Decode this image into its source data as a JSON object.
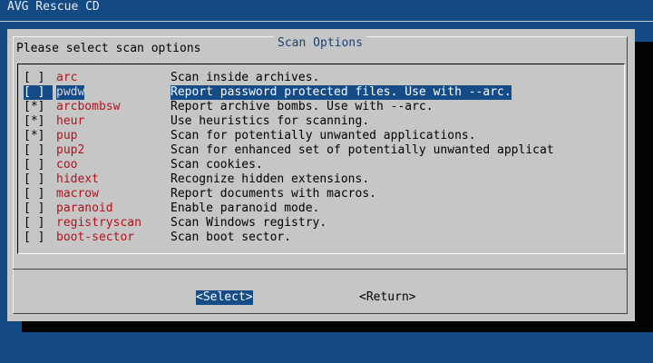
{
  "app": {
    "backtitle": "AVG Rescue CD"
  },
  "dialog": {
    "title": "Scan Options",
    "prompt": "Please select scan options",
    "options": [
      {
        "check": "[ ]",
        "tag": "arc",
        "desc": "Scan inside archives.",
        "selected": false
      },
      {
        "check": "[ ]",
        "tag": "pwdw",
        "desc": "Report password protected files. Use with --arc.",
        "selected": true
      },
      {
        "check": "[*]",
        "tag": "arcbombsw",
        "desc": "Report archive bombs. Use with --arc.",
        "selected": false
      },
      {
        "check": "[*]",
        "tag": "heur",
        "desc": "Use heuristics for scanning.",
        "selected": false
      },
      {
        "check": "[*]",
        "tag": "pup",
        "desc": "Scan for potentially unwanted applications.",
        "selected": false
      },
      {
        "check": "[ ]",
        "tag": "pup2",
        "desc": "Scan for enhanced set of potentially unwanted applicat",
        "selected": false
      },
      {
        "check": "[ ]",
        "tag": "coo",
        "desc": "Scan cookies.",
        "selected": false
      },
      {
        "check": "[ ]",
        "tag": "hidext",
        "desc": "Recognize hidden extensions.",
        "selected": false
      },
      {
        "check": "[ ]",
        "tag": "macrow",
        "desc": "Report documents with macros.",
        "selected": false
      },
      {
        "check": "[ ]",
        "tag": "paranoid",
        "desc": "Enable paranoid mode.",
        "selected": false
      },
      {
        "check": "[ ]",
        "tag": "registryscan",
        "desc": "Scan Windows registry.",
        "selected": false
      },
      {
        "check": "[ ]",
        "tag": "boot-sector",
        "desc": "Scan boot sector.",
        "selected": false
      }
    ],
    "buttons": {
      "select": "<Select>",
      "return": "<Return>"
    }
  },
  "colors": {
    "background": "#144a84",
    "dialog": "#c6c6c6",
    "highlight": "#154b87",
    "tag": "#b3121c"
  }
}
